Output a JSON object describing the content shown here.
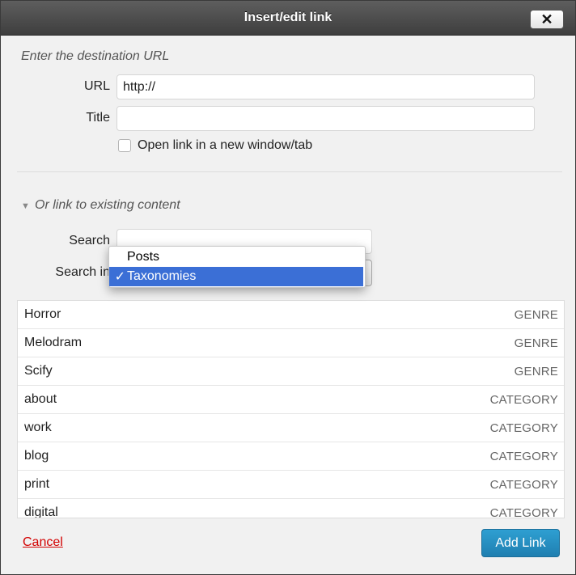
{
  "dialog": {
    "title": "Insert/edit link",
    "close_glyph": "✕"
  },
  "url_section": {
    "heading": "Enter the destination URL",
    "url_label": "URL",
    "url_value": "http://",
    "title_label": "Title",
    "title_value": "",
    "new_window_label": "Open link in a new window/tab",
    "new_window_checked": false
  },
  "existing_section": {
    "heading": "Or link to existing content",
    "search_label": "Search",
    "search_value": "",
    "search_in_label": "Search in",
    "search_in_options": [
      {
        "label": "Posts",
        "selected": false
      },
      {
        "label": "Taxonomies",
        "selected": true
      }
    ],
    "check_glyph": "✓"
  },
  "results": [
    {
      "title": "Horror",
      "type": "GENRE"
    },
    {
      "title": "Melodram",
      "type": "GENRE"
    },
    {
      "title": "Scify",
      "type": "GENRE"
    },
    {
      "title": "about",
      "type": "CATEGORY"
    },
    {
      "title": "work",
      "type": "CATEGORY"
    },
    {
      "title": "blog",
      "type": "CATEGORY"
    },
    {
      "title": "print",
      "type": "CATEGORY"
    },
    {
      "title": "digital",
      "type": "CATEGORY"
    }
  ],
  "footer": {
    "cancel_label": "Cancel",
    "submit_label": "Add Link"
  },
  "colors": {
    "accent": "#2585bd",
    "cancel": "#d20000",
    "selection": "#3b6fd6"
  }
}
